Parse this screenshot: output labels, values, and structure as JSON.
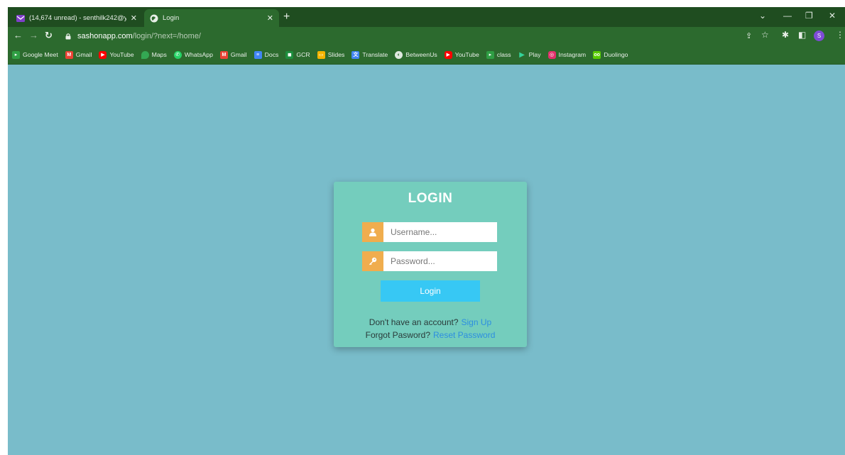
{
  "browser": {
    "tabs": [
      {
        "title": "(14,674 unread) - senthilk242@y",
        "active": false,
        "icon": "mail-icon"
      },
      {
        "title": "Login",
        "active": true,
        "icon": "globe-icon"
      }
    ],
    "address": {
      "host": "sashonapp.com",
      "path": "/login/?next=/home/"
    },
    "profile_initial": "S",
    "bookmarks": [
      {
        "label": "Google Meet",
        "icon": "meet-icon",
        "color": "#2f9e44"
      },
      {
        "label": "Gmail",
        "icon": "gmail-icon",
        "color": "#ea4335"
      },
      {
        "label": "YouTube",
        "icon": "youtube-icon",
        "color": "#ff0000"
      },
      {
        "label": "Maps",
        "icon": "maps-icon",
        "color": "#34a853"
      },
      {
        "label": "WhatsApp",
        "icon": "whatsapp-icon",
        "color": "#25d366"
      },
      {
        "label": "Gmail",
        "icon": "gmail-icon",
        "color": "#ea4335"
      },
      {
        "label": "Docs",
        "icon": "docs-icon",
        "color": "#4285f4"
      },
      {
        "label": "GCR",
        "icon": "classroom-icon",
        "color": "#1e8e3e"
      },
      {
        "label": "Slides",
        "icon": "slides-icon",
        "color": "#f4b400"
      },
      {
        "label": "Translate",
        "icon": "translate-icon",
        "color": "#4285f4"
      },
      {
        "label": "BetweenUs",
        "icon": "globe-icon",
        "color": "#dfe8df"
      },
      {
        "label": "YouTube",
        "icon": "youtube-icon",
        "color": "#ff0000"
      },
      {
        "label": "class",
        "icon": "meet-icon",
        "color": "#2f9e44"
      },
      {
        "label": "Play",
        "icon": "play-store-icon",
        "color": "#01875f"
      },
      {
        "label": "Instagram",
        "icon": "instagram-icon",
        "color": "#e1306c"
      },
      {
        "label": "Duolingo",
        "icon": "duolingo-icon",
        "color": "#58cc02"
      }
    ]
  },
  "login": {
    "title": "LOGIN",
    "username_placeholder": "Username...",
    "password_placeholder": "Password...",
    "submit_label": "Login",
    "signup_prompt": "Don't have an account?",
    "signup_link": "Sign Up",
    "forgot_prompt": "Forgot Pasword?",
    "reset_link": "Reset Password"
  },
  "colors": {
    "page_bg": "#79bcca",
    "card_bg": "#74cdbd",
    "icon_bg": "#f0ad4e",
    "button_bg": "#37c8f4",
    "link": "#2d8ee0",
    "chrome_dark": "#1f4d20",
    "chrome": "#2c6a2e"
  }
}
